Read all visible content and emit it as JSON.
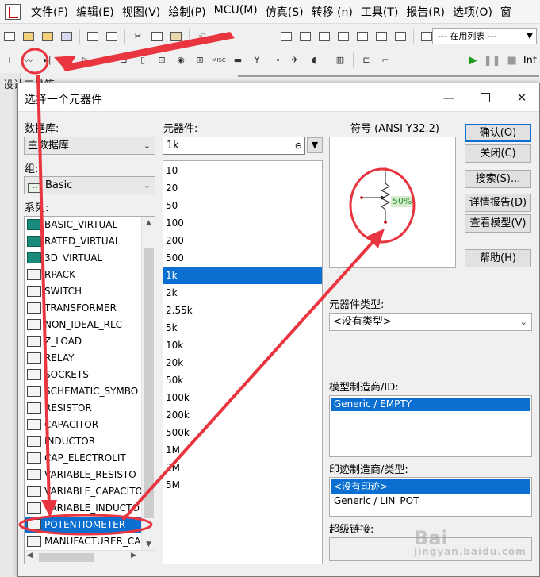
{
  "menu": [
    "文件(F)",
    "编辑(E)",
    "视图(V)",
    "绘制(P)",
    "MCU(M)",
    "仿真(S)",
    "转移 (n)",
    "工具(T)",
    "报告(R)",
    "选项(O)",
    "窗"
  ],
  "toolbar": {
    "in_use_list": "--- 在用列表 ---",
    "right_label": "Int"
  },
  "behind_panel_title": "设计工具箱",
  "dialog": {
    "title": "选择一个元器件",
    "database_label": "数据库:",
    "database_value": "主数据库",
    "group_label": "组:",
    "group_value": "Basic",
    "family_label": "系列:",
    "families": [
      {
        "label": "BASIC_VIRTUAL",
        "icon": "basic-virtual-icon",
        "selected": false
      },
      {
        "label": "RATED_VIRTUAL",
        "icon": "rated-virtual-icon",
        "selected": false
      },
      {
        "label": "3D_VIRTUAL",
        "icon": "3d-virtual-icon",
        "selected": false
      },
      {
        "label": "RPACK",
        "icon": "rpack-icon",
        "selected": false
      },
      {
        "label": "SWITCH",
        "icon": "switch-icon",
        "selected": false
      },
      {
        "label": "TRANSFORMER",
        "icon": "transformer-icon",
        "selected": false
      },
      {
        "label": "NON_IDEAL_RLC",
        "icon": "non-ideal-rlc-icon",
        "selected": false
      },
      {
        "label": "Z_LOAD",
        "icon": "z-load-icon",
        "selected": false
      },
      {
        "label": "RELAY",
        "icon": "relay-icon",
        "selected": false
      },
      {
        "label": "SOCKETS",
        "icon": "sockets-icon",
        "selected": false
      },
      {
        "label": "SCHEMATIC_SYMBO",
        "icon": "schematic-symbol-icon",
        "selected": false
      },
      {
        "label": "RESISTOR",
        "icon": "resistor-icon",
        "selected": false
      },
      {
        "label": "CAPACITOR",
        "icon": "capacitor-icon",
        "selected": false
      },
      {
        "label": "INDUCTOR",
        "icon": "inductor-icon",
        "selected": false
      },
      {
        "label": "CAP_ELECTROLIT",
        "icon": "cap-electrolit-icon",
        "selected": false
      },
      {
        "label": "VARIABLE_RESISTO",
        "icon": "variable-resistor-icon",
        "selected": false
      },
      {
        "label": "VARIABLE_CAPACITO",
        "icon": "variable-capacitor-icon",
        "selected": false
      },
      {
        "label": "VARIABLE_INDUCTO",
        "icon": "variable-inductor-icon",
        "selected": false
      },
      {
        "label": "POTENTIOMETER",
        "icon": "potentiometer-icon",
        "selected": true
      },
      {
        "label": "MANUFACTURER_CA",
        "icon": "manufacturer-cap-icon",
        "selected": false
      }
    ],
    "component_label": "元器件:",
    "component_value": "1k",
    "components": [
      {
        "label": "10",
        "selected": false
      },
      {
        "label": "20",
        "selected": false
      },
      {
        "label": "50",
        "selected": false
      },
      {
        "label": "100",
        "selected": false
      },
      {
        "label": "200",
        "selected": false
      },
      {
        "label": "500",
        "selected": false
      },
      {
        "label": "1k",
        "selected": true
      },
      {
        "label": "2k",
        "selected": false
      },
      {
        "label": "2.55k",
        "selected": false
      },
      {
        "label": "5k",
        "selected": false
      },
      {
        "label": "10k",
        "selected": false
      },
      {
        "label": "20k",
        "selected": false
      },
      {
        "label": "50k",
        "selected": false
      },
      {
        "label": "100k",
        "selected": false
      },
      {
        "label": "200k",
        "selected": false
      },
      {
        "label": "500k",
        "selected": false
      },
      {
        "label": "1M",
        "selected": false
      },
      {
        "label": "2M",
        "selected": false
      },
      {
        "label": "5M",
        "selected": false
      }
    ],
    "symbol_label": "符号 (ANSI Y32.2)",
    "symbol_percent": "50%",
    "buttons": {
      "ok": "确认(O)",
      "close": "关闭(C)",
      "search": "搜索(S)...",
      "detail": "详情报告(D)",
      "view_model": "查看模型(V)",
      "help": "帮助(H)"
    },
    "component_type_label": "元器件类型:",
    "component_type_value": "<没有类型>",
    "model_label": "模型制造商/ID:",
    "model_rows": [
      {
        "label": "Generic / EMPTY",
        "selected": true
      }
    ],
    "footprint_label": "印迹制造商/类型:",
    "footprint_rows": [
      {
        "label": "<没有印迹>",
        "selected": true
      },
      {
        "label": "Generic / LIN_POT",
        "selected": false
      }
    ],
    "hyperlink_label": "超级链接:",
    "hyperlink_value": ""
  },
  "colors": {
    "selection": "#0a6fd0",
    "annotation": "#e8353f",
    "dialog_bg": "#f0f0f0"
  },
  "watermark": {
    "text": "Bai",
    "sub": "jingyan.baidu.com"
  }
}
